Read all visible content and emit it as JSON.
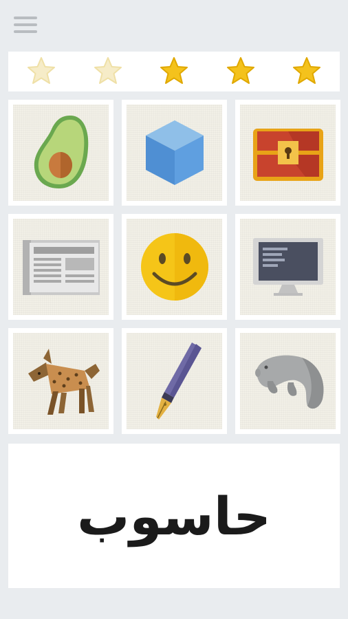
{
  "header": {
    "menu_icon": "hamburger-menu-icon"
  },
  "rating": {
    "total": 5,
    "filled": 3,
    "colors": {
      "filled": "#f4c21c",
      "filled_stroke": "#e0a800",
      "empty": "#f6ecc8",
      "empty_stroke": "#efe0a6"
    }
  },
  "tiles": [
    {
      "name": "avocado",
      "icon": "avocado-icon"
    },
    {
      "name": "cube",
      "icon": "cube-icon"
    },
    {
      "name": "treasure-chest",
      "icon": "treasure-chest-icon"
    },
    {
      "name": "newspaper",
      "icon": "newspaper-icon"
    },
    {
      "name": "smiley",
      "icon": "smiley-face-icon"
    },
    {
      "name": "computer",
      "icon": "computer-monitor-icon"
    },
    {
      "name": "hyena",
      "icon": "hyena-icon"
    },
    {
      "name": "fountain-pen",
      "icon": "fountain-pen-icon"
    },
    {
      "name": "manatee",
      "icon": "manatee-icon"
    }
  ],
  "word": "حاسوب"
}
